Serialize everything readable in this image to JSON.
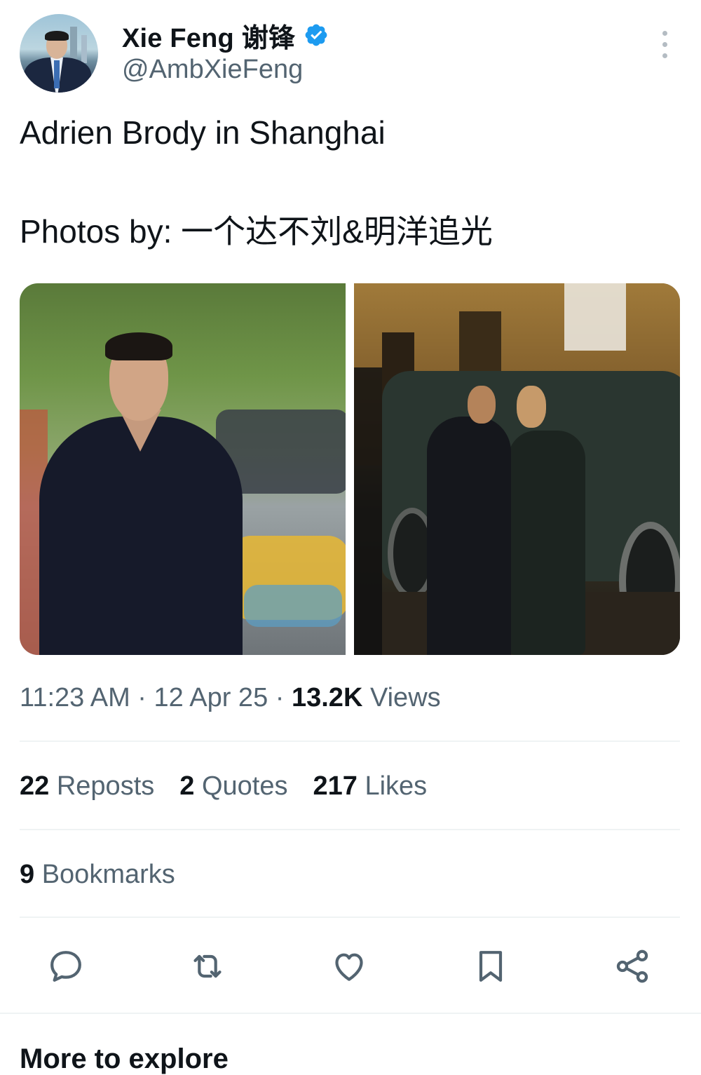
{
  "tweet": {
    "author": {
      "display_name": "Xie Feng 谢锋",
      "handle": "@AmbXieFeng",
      "verified": true,
      "verified_color": "#1d9bf0"
    },
    "text_lines": [
      "Adrien Brody in Shanghai",
      "Photos by: 一个达不刘&明洋追光"
    ],
    "media": [
      {
        "name": "photo-1"
      },
      {
        "name": "photo-2"
      }
    ],
    "time": "11:23 AM",
    "date": "12 Apr 25",
    "separator": "·",
    "views_count": "13.2K",
    "views_label": "Views"
  },
  "stats": {
    "reposts": {
      "count": "22",
      "label": "Reposts"
    },
    "quotes": {
      "count": "2",
      "label": "Quotes"
    },
    "likes": {
      "count": "217",
      "label": "Likes"
    },
    "bookmarks": {
      "count": "9",
      "label": "Bookmarks"
    }
  },
  "actions": [
    "reply-icon",
    "repost-icon",
    "like-icon",
    "bookmark-icon",
    "share-icon"
  ],
  "more_section_title": "More to explore",
  "colors": {
    "text_primary": "#0f1419",
    "text_secondary": "#536471",
    "divider": "#eff3f4",
    "icon": "#536471"
  }
}
